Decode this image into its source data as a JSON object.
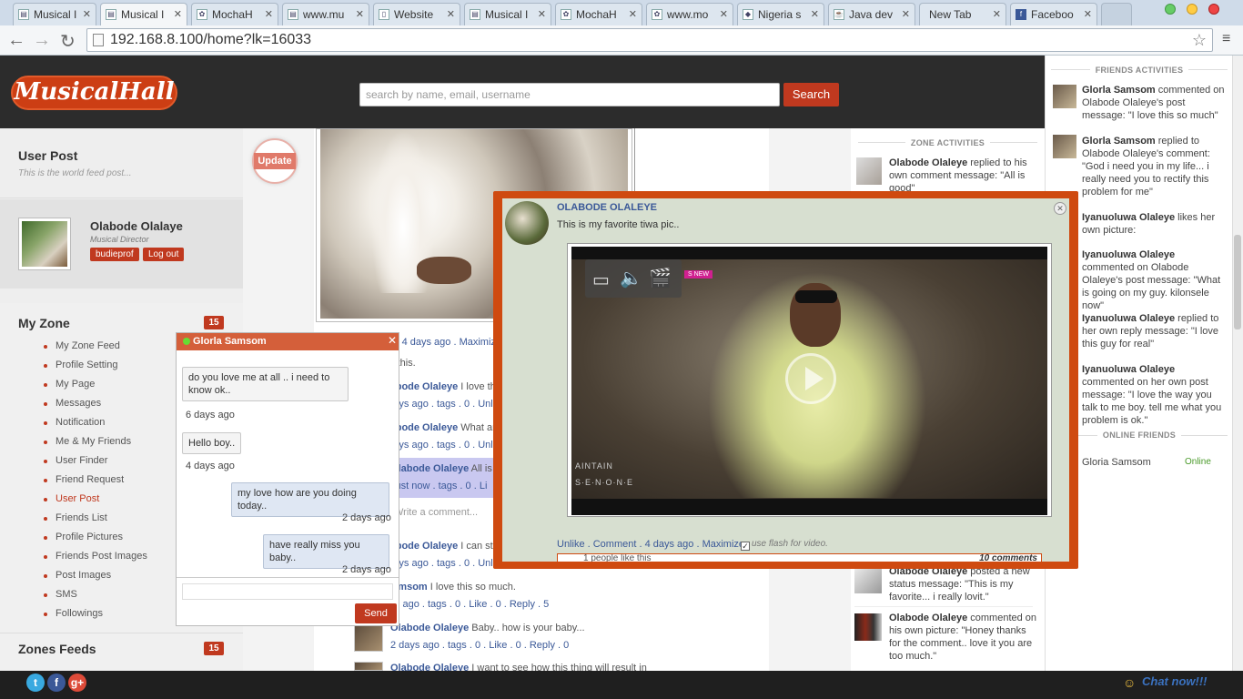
{
  "browser": {
    "tabs": [
      {
        "label": "Musical I"
      },
      {
        "label": "Musical I"
      },
      {
        "label": "MochaH"
      },
      {
        "label": "www.mu"
      },
      {
        "label": "Website"
      },
      {
        "label": "Musical I"
      },
      {
        "label": "MochaH"
      },
      {
        "label": "www.mo"
      },
      {
        "label": "Nigeria s"
      },
      {
        "label": "Java dev"
      },
      {
        "label": "New Tab"
      },
      {
        "label": "Faceboo"
      }
    ],
    "url": "192.168.8.100/home?lk=16033"
  },
  "header": {
    "logo": "MusicalHall",
    "search_placeholder": "search by name, email, username",
    "search_button": "Search"
  },
  "sidebar": {
    "user_post_title": "User Post",
    "user_post_sub": "This is the world feed post...",
    "user_name": "Olabode Olalaye",
    "user_role": "Musical Director",
    "btn_profile": "budieprof",
    "btn_logout": "Log out",
    "myzone_title": "My Zone",
    "myzone_count": "15",
    "menu": [
      "My Zone Feed",
      "Profile Setting",
      "My Page",
      "Messages",
      "Notification",
      "Me & My Friends",
      "User Finder",
      "Friend Request",
      "User Post",
      "Friends List",
      "Profile Pictures",
      "Friends Post Images",
      "Post Images",
      "SMS",
      "Followings"
    ],
    "zones_title": "Zones Feeds",
    "zones_count": "15"
  },
  "feed": {
    "update_btn": "Update",
    "item_meta_1": "Unlike . Comment . 4 days ago . Maximize.",
    "item_time_1": "6 days ago",
    "item_text_1": "like this.",
    "row1_name": "Olabode Olaleye",
    "row1_text": "I love this musi",
    "row1_meta": "4 days ago . tags . 0 . Unlike .",
    "row2_name": "Olabode Olaleye",
    "row2_text": "What are you d",
    "row2_meta": "2 days ago . tags . 0 . Unlike .",
    "row3_name": "Olabode Olaleye",
    "row3_text": "All is g",
    "row3_meta": "Just now . tags . 0 . Li",
    "write_comment": "Write a comment...",
    "row4_name": "Olabode Olaleye",
    "row4_text": "I can stop lovin",
    "row4_meta": "2 days ago . tags . 0 . Unlike .",
    "row5_name": "Gloria Samsom",
    "row5_text": "I love this so much.",
    "row5_meta": "4 days ago . tags . 0 . Like . 0 . Reply . 5",
    "row6_name": "Olabode Olaleye",
    "row6_text": "Baby.. how is your baby...",
    "row6_meta": "2 days ago . tags . 0 . Like . 0 . Reply . 0",
    "row7_name": "Olabode Olaleye",
    "row7_text": "I want to see how this thing will result in"
  },
  "zone": {
    "title": "ZONE ACTIVITIES",
    "a1_name": "Olabode Olaleye",
    "a1_text": "replied to his own comment message: \"All is good\"",
    "a2_name": "Olabode Olaleye",
    "a2_text": "posted a new status message: \"This is my favorite... i really lovit.\"",
    "a3_name": "Olabode Olaleye",
    "a3_text": "commented on his own picture: \"Honey thanks for the comment.. love it you are too much.\""
  },
  "rail": {
    "title": "FRIENDS ACTIVITIES",
    "items": [
      {
        "name": "Glorla Samsom",
        "text": "commented on Olabode Olaleye's post message: \"I love this so much\""
      },
      {
        "name": "Glorla Samsom",
        "text": "replied to Olabode Olaleye's comment: \"God i need you in my life... i really need you to rectify this problem for me\""
      },
      {
        "name": "Iyanuoluwa Olaleye",
        "text": "likes her own picture:"
      },
      {
        "name": "Iyanuoluwa Olaleye",
        "text": "commented on Olabode Olaleye's post message: \"What is going on my guy. kilonsele now\""
      },
      {
        "name": "Iyanuoluwa Olaleye",
        "text": "replied to her own reply message: \"I love this guy for real\""
      },
      {
        "name": "Iyanuoluwa Olaleye",
        "text": "commented on her own post message: \"I love the way you talk to me boy. tell me what you problem is ok.\""
      }
    ],
    "online_title": "ONLINE FRIENDS",
    "online_name": "Gloria Samsom",
    "online_status": "Online"
  },
  "chat": {
    "name": "Glorla Samsom",
    "m1": "do you love me at all .. i need to know ok..",
    "t1": "6 days ago",
    "m2": "Hello boy..",
    "t2": "4 days ago",
    "m3": "my love how are you doing today..",
    "t3": "2 days ago",
    "m4": "have really miss you baby..",
    "t4": "2 days ago",
    "send": "Send"
  },
  "overlay": {
    "name": "OLABODE OLALEYE",
    "text": "This is my favorite tiwa pic..",
    "video_label_1": "AINTAIN",
    "video_label_2": "S·E·N·O·N·E",
    "video_new": "S NEW",
    "actions": "Unlike . Comment . 4 days ago . Maximize.",
    "flash": "use flash for video.",
    "likes": "1 people like this",
    "comments": "10 comments"
  },
  "bottom": {
    "chat_now": "Chat now!!!"
  },
  "colors": {
    "brand": "#c0391f",
    "header_bg": "#2c2c2c",
    "overlay_border": "#cf4a10",
    "link": "#3b5998"
  }
}
